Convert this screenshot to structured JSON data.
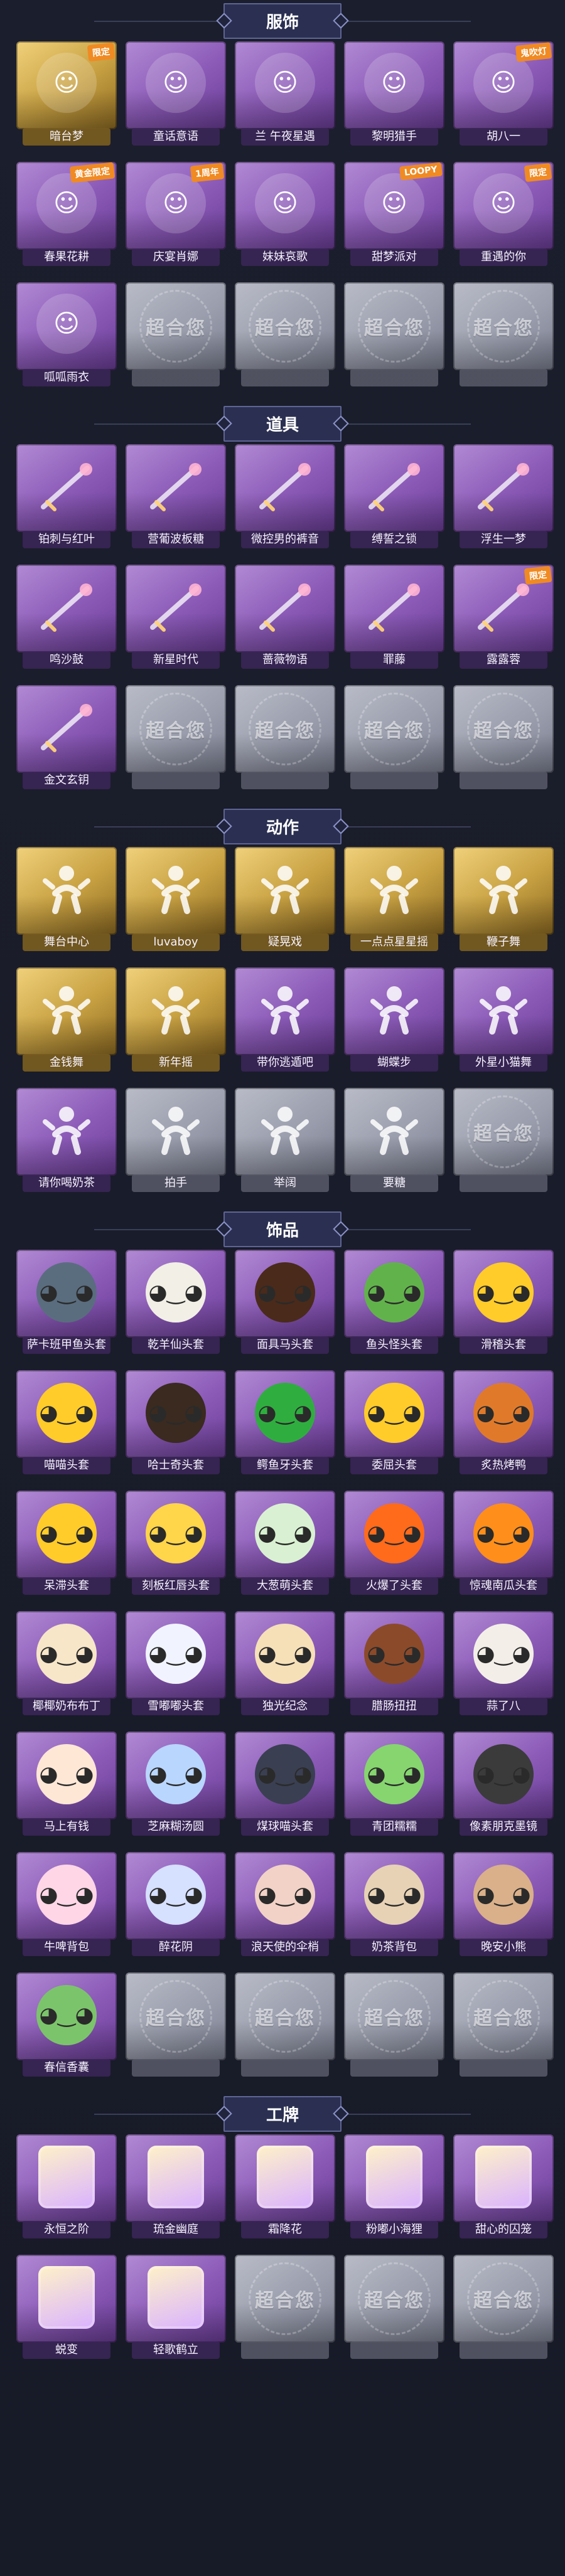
{
  "sections": [
    {
      "title": "服饰",
      "items": [
        {
          "label": "暗台梦",
          "tier": "gold",
          "badge": "限定",
          "icon": "character-portrait-icon"
        },
        {
          "label": "童话意语",
          "tier": "purple",
          "icon": "character-portrait-icon"
        },
        {
          "label": "兰 午夜星遇",
          "tier": "purple",
          "icon": "character-portrait-icon"
        },
        {
          "label": "黎明猎手",
          "tier": "purple",
          "icon": "character-portrait-icon"
        },
        {
          "label": "胡八一",
          "tier": "purple",
          "badge": "鬼吹灯",
          "icon": "character-portrait-icon"
        },
        {
          "label": "春果花耕",
          "tier": "purple",
          "badge": "黄金限定",
          "icon": "character-portrait-icon"
        },
        {
          "label": "庆宴肖娜",
          "tier": "purple",
          "badge": "1周年",
          "icon": "character-portrait-icon"
        },
        {
          "label": "妹妹哀歌",
          "tier": "purple",
          "icon": "character-portrait-icon"
        },
        {
          "label": "甜梦派对",
          "tier": "purple",
          "badge": "LOOPY",
          "icon": "character-portrait-icon"
        },
        {
          "label": "重遇的你",
          "tier": "purple",
          "badge": "限定",
          "icon": "character-portrait-icon"
        },
        {
          "label": "呱呱雨衣",
          "tier": "purple",
          "icon": "character-portrait-icon"
        },
        {
          "label": "",
          "tier": "gray",
          "watermark": "超合您",
          "icon": "locked-placeholder-icon"
        },
        {
          "label": "",
          "tier": "gray",
          "watermark": "超合您",
          "icon": "locked-placeholder-icon"
        },
        {
          "label": "",
          "tier": "gray",
          "watermark": "超合您",
          "icon": "locked-placeholder-icon"
        },
        {
          "label": "",
          "tier": "gray",
          "watermark": "超合您",
          "icon": "locked-placeholder-icon"
        }
      ]
    },
    {
      "title": "道具",
      "items": [
        {
          "label": "铂刺与红叶",
          "tier": "purple",
          "icon": "prop-weapon-icon"
        },
        {
          "label": "营葡波板糖",
          "tier": "purple",
          "icon": "prop-weapon-icon"
        },
        {
          "label": "微控男的裤音",
          "tier": "purple",
          "icon": "prop-weapon-icon"
        },
        {
          "label": "缚誓之锁",
          "tier": "purple",
          "icon": "prop-weapon-icon"
        },
        {
          "label": "浮生一梦",
          "tier": "purple",
          "icon": "prop-weapon-icon"
        },
        {
          "label": "鸣沙鼓",
          "tier": "purple",
          "icon": "prop-weapon-icon"
        },
        {
          "label": "新星时代",
          "tier": "purple",
          "icon": "prop-weapon-icon"
        },
        {
          "label": "蔷薇物语",
          "tier": "purple",
          "icon": "prop-weapon-icon"
        },
        {
          "label": "罪藤",
          "tier": "purple",
          "icon": "prop-weapon-icon"
        },
        {
          "label": "露露蓉",
          "tier": "purple",
          "badge": "限定",
          "icon": "prop-weapon-icon"
        },
        {
          "label": "金文玄钥",
          "tier": "purple",
          "icon": "prop-weapon-icon"
        },
        {
          "label": "",
          "tier": "gray",
          "watermark": "超合您",
          "icon": "locked-placeholder-icon"
        },
        {
          "label": "",
          "tier": "gray",
          "watermark": "超合您",
          "icon": "locked-placeholder-icon"
        },
        {
          "label": "",
          "tier": "gray",
          "watermark": "超合您",
          "icon": "locked-placeholder-icon"
        },
        {
          "label": "",
          "tier": "gray",
          "watermark": "超合您",
          "icon": "locked-placeholder-icon"
        }
      ]
    },
    {
      "title": "动作",
      "items": [
        {
          "label": "舞台中心",
          "tier": "gold",
          "icon": "motion-figure-icon"
        },
        {
          "label": "luvaboy",
          "tier": "gold",
          "icon": "motion-figure-icon"
        },
        {
          "label": "疑晃戏",
          "tier": "gold",
          "icon": "motion-figure-icon"
        },
        {
          "label": "一点点星星摇",
          "tier": "gold",
          "icon": "motion-figure-icon"
        },
        {
          "label": "鞭子舞",
          "tier": "gold",
          "icon": "motion-figure-icon"
        },
        {
          "label": "金钱舞",
          "tier": "gold",
          "icon": "motion-figure-icon"
        },
        {
          "label": "新年摇",
          "tier": "gold",
          "icon": "motion-figure-icon"
        },
        {
          "label": "带你逃遁吧",
          "tier": "purple",
          "icon": "motion-figure-icon"
        },
        {
          "label": "蝴蝶步",
          "tier": "purple",
          "icon": "motion-figure-icon"
        },
        {
          "label": "外星小猫舞",
          "tier": "purple",
          "icon": "motion-figure-icon"
        },
        {
          "label": "请你喝奶茶",
          "tier": "purple",
          "icon": "motion-figure-icon"
        },
        {
          "label": "拍手",
          "tier": "gray",
          "icon": "motion-figure-icon"
        },
        {
          "label": "举阔",
          "tier": "gray",
          "icon": "motion-figure-icon"
        },
        {
          "label": "要糖",
          "tier": "gray",
          "icon": "motion-figure-icon"
        },
        {
          "label": "",
          "tier": "gray",
          "watermark": "超合您",
          "icon": "locked-placeholder-icon"
        }
      ]
    },
    {
      "title": "饰品",
      "items": [
        {
          "label": "萨卡班甲鱼头套",
          "tier": "purple",
          "icon": "head-accessory-icon",
          "head": "#5a6d7f"
        },
        {
          "label": "乾羊仙头套",
          "tier": "purple",
          "icon": "head-accessory-icon",
          "head": "#f2efe6"
        },
        {
          "label": "面具马头套",
          "tier": "purple",
          "icon": "head-accessory-icon",
          "head": "#4a2a1a"
        },
        {
          "label": "鱼头怪头套",
          "tier": "purple",
          "icon": "head-accessory-icon",
          "head": "#62b24c"
        },
        {
          "label": "滑稽头套",
          "tier": "purple",
          "icon": "head-accessory-icon",
          "head": "#ffcc2a"
        },
        {
          "label": "喵喵头套",
          "tier": "purple",
          "icon": "head-accessory-icon",
          "head": "#ffcc2a"
        },
        {
          "label": "哈士奇头套",
          "tier": "purple",
          "icon": "head-accessory-icon",
          "head": "#3a2a20"
        },
        {
          "label": "鳄鱼牙头套",
          "tier": "purple",
          "icon": "head-accessory-icon",
          "head": "#2fae3f"
        },
        {
          "label": "委屈头套",
          "tier": "purple",
          "icon": "head-accessory-icon",
          "head": "#ffcc2a"
        },
        {
          "label": "炙热烤鸭",
          "tier": "purple",
          "icon": "head-accessory-icon",
          "head": "#e07a2a"
        },
        {
          "label": "呆滞头套",
          "tier": "purple",
          "icon": "head-accessory-icon",
          "head": "#ffcc2a"
        },
        {
          "label": "刻板红唇头套",
          "tier": "purple",
          "icon": "head-accessory-icon",
          "head": "#ffd54a"
        },
        {
          "label": "大葱萌头套",
          "tier": "purple",
          "icon": "head-accessory-icon",
          "head": "#d9f1d2"
        },
        {
          "label": "火爆了头套",
          "tier": "purple",
          "icon": "head-accessory-icon",
          "head": "#ff6b1a"
        },
        {
          "label": "惊魂南瓜头套",
          "tier": "purple",
          "icon": "head-accessory-icon",
          "head": "#ff8f1a"
        },
        {
          "label": "椰椰奶布布丁",
          "tier": "purple",
          "icon": "head-accessory-icon",
          "head": "#f7e6c8"
        },
        {
          "label": "雪嘟嘟头套",
          "tier": "purple",
          "icon": "head-accessory-icon",
          "head": "#f1f4ff"
        },
        {
          "label": "独光纪念",
          "tier": "purple",
          "icon": "head-accessory-icon",
          "head": "#f6e0b8"
        },
        {
          "label": "腊肠扭扭",
          "tier": "purple",
          "icon": "head-accessory-icon",
          "head": "#8b4a2a"
        },
        {
          "label": "蒜了八",
          "tier": "purple",
          "icon": "head-accessory-icon",
          "head": "#f3efe8"
        },
        {
          "label": "马上有钱",
          "tier": "purple",
          "icon": "head-accessory-icon",
          "head": "#ffe7d6"
        },
        {
          "label": "芝麻糊汤圆",
          "tier": "purple",
          "icon": "head-accessory-icon",
          "head": "#b9d6ff"
        },
        {
          "label": "煤球喵头套",
          "tier": "purple",
          "icon": "head-accessory-icon",
          "head": "#3a3f52"
        },
        {
          "label": "青团糯糯",
          "tier": "purple",
          "icon": "head-accessory-icon",
          "head": "#86d56f"
        },
        {
          "label": "像素朋克墨镜",
          "tier": "purple",
          "icon": "head-accessory-icon",
          "head": "#3b3b3b"
        },
        {
          "label": "牛啤背包",
          "tier": "purple",
          "icon": "head-accessory-icon",
          "head": "#ffd6e6"
        },
        {
          "label": "醉花阴",
          "tier": "purple",
          "icon": "head-accessory-icon",
          "head": "#d6e0ff"
        },
        {
          "label": "浪天使的伞梢",
          "tier": "purple",
          "icon": "head-accessory-icon",
          "head": "#f2d2c6"
        },
        {
          "label": "奶茶背包",
          "tier": "purple",
          "icon": "head-accessory-icon",
          "head": "#e7d2b5"
        },
        {
          "label": "晚安小熊",
          "tier": "purple",
          "icon": "head-accessory-icon",
          "head": "#d9b08a"
        },
        {
          "label": "春信香囊",
          "tier": "purple",
          "icon": "head-accessory-icon",
          "head": "#7cc46b"
        },
        {
          "label": "",
          "tier": "gray",
          "watermark": "超合您",
          "icon": "locked-placeholder-icon"
        },
        {
          "label": "",
          "tier": "gray",
          "watermark": "超合您",
          "icon": "locked-placeholder-icon"
        },
        {
          "label": "",
          "tier": "gray",
          "watermark": "超合您",
          "icon": "locked-placeholder-icon"
        },
        {
          "label": "",
          "tier": "gray",
          "watermark": "超合您",
          "icon": "locked-placeholder-icon"
        }
      ]
    },
    {
      "title": "工牌",
      "items": [
        {
          "label": "永恒之阶",
          "tier": "purple",
          "icon": "badge-plate-icon"
        },
        {
          "label": "琉金幽庭",
          "tier": "purple",
          "icon": "badge-plate-icon"
        },
        {
          "label": "霜降花",
          "tier": "purple",
          "icon": "badge-plate-icon"
        },
        {
          "label": "粉嘟小海狸",
          "tier": "purple",
          "icon": "badge-plate-icon"
        },
        {
          "label": "甜心的囚笼",
          "tier": "purple",
          "icon": "badge-plate-icon"
        },
        {
          "label": "蜕变",
          "tier": "purple",
          "icon": "badge-plate-icon"
        },
        {
          "label": "轻歌鹤立",
          "tier": "purple",
          "icon": "badge-plate-icon"
        },
        {
          "label": "",
          "tier": "gray",
          "watermark": "超合您",
          "icon": "locked-placeholder-icon"
        },
        {
          "label": "",
          "tier": "gray",
          "watermark": "超合您",
          "icon": "locked-placeholder-icon"
        },
        {
          "label": "",
          "tier": "gray",
          "watermark": "超合您",
          "icon": "locked-placeholder-icon"
        }
      ]
    }
  ]
}
